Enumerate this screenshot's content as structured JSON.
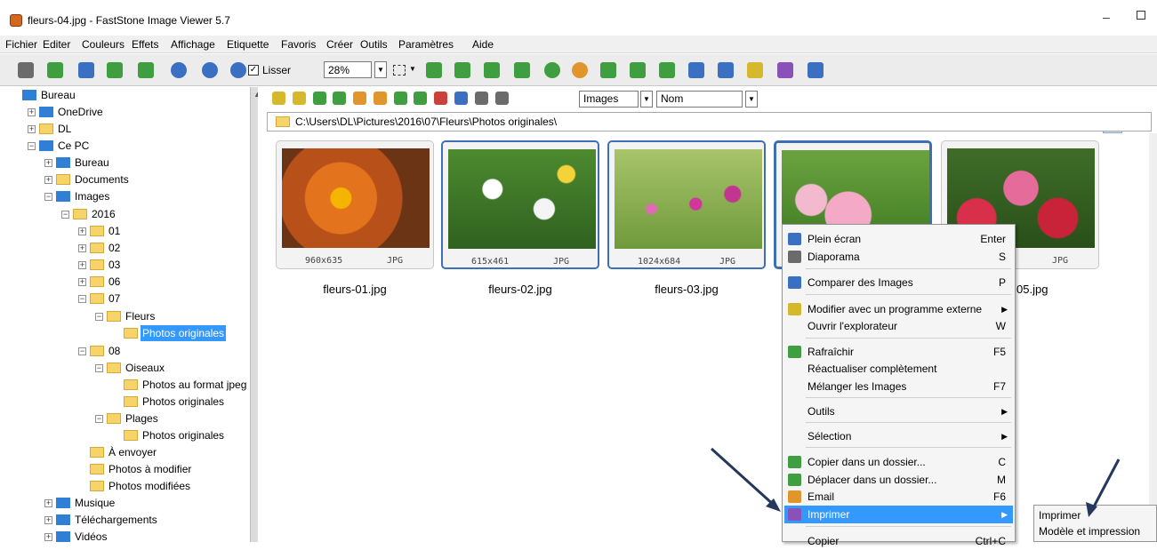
{
  "window": {
    "title": "fleurs-04.jpg  -  FastStone Image Viewer 5.7",
    "minimize_glyph": "–"
  },
  "menu": [
    "Fichier",
    "Editer",
    "Couleurs",
    "Effets",
    "Affichage",
    "Etiquette",
    "Favoris",
    "Créer",
    "Outils",
    "Paramètres",
    "Aide"
  ],
  "toolbar": {
    "smooth_label": "Lisser",
    "smooth_checked": true,
    "zoom": "28%"
  },
  "nav": {
    "filter": "Images",
    "sort": "Nom"
  },
  "path": "C:\\Users\\DL\\Pictures\\2016\\07\\Fleurs\\Photos originales\\",
  "tree": [
    {
      "label": "Bureau",
      "icon": "desktop-icon"
    },
    {
      "label": "OneDrive",
      "icon": "cloud-icon"
    },
    {
      "label": "DL",
      "icon": "user-icon"
    },
    {
      "label": "Ce PC",
      "icon": "computer-icon"
    },
    {
      "label": "Bureau",
      "icon": "desktop-icon"
    },
    {
      "label": "Documents",
      "icon": "documents-icon"
    },
    {
      "label": "Images",
      "icon": "images-icon"
    },
    {
      "label": "2016",
      "icon": "folder-icon"
    },
    {
      "label": "01",
      "icon": "folder-icon"
    },
    {
      "label": "02",
      "icon": "folder-icon"
    },
    {
      "label": "03",
      "icon": "folder-icon"
    },
    {
      "label": "06",
      "icon": "folder-icon"
    },
    {
      "label": "07",
      "icon": "folder-icon"
    },
    {
      "label": "Fleurs",
      "icon": "folder-icon"
    },
    {
      "label": "Photos originales",
      "icon": "folder-icon",
      "selected": true
    },
    {
      "label": "08",
      "icon": "folder-icon"
    },
    {
      "label": "Oiseaux",
      "icon": "folder-icon"
    },
    {
      "label": "Photos au format jpeg",
      "icon": "folder-icon"
    },
    {
      "label": "Photos originales",
      "icon": "folder-icon"
    },
    {
      "label": "Plages",
      "icon": "folder-icon"
    },
    {
      "label": "Photos originales",
      "icon": "folder-icon"
    },
    {
      "label": "À envoyer",
      "icon": "folder-icon"
    },
    {
      "label": "Photos à modifier",
      "icon": "folder-icon"
    },
    {
      "label": "Photos modifiées",
      "icon": "folder-icon"
    },
    {
      "label": "Musique",
      "icon": "music-icon"
    },
    {
      "label": "Téléchargements",
      "icon": "download-icon"
    },
    {
      "label": "Vidéos",
      "icon": "video-icon"
    }
  ],
  "thumbnails": [
    {
      "dims": "960x635",
      "format": "JPG",
      "name": "fleurs-01.jpg"
    },
    {
      "dims": "615x461",
      "format": "JPG",
      "name": "fleurs-02.jpg"
    },
    {
      "dims": "1024x684",
      "format": "JPG",
      "name": "fleurs-03.jpg"
    },
    {
      "dims": "",
      "format": "",
      "name": ""
    },
    {
      "dims": "",
      "format": "JPG",
      "name": "05.jpg"
    }
  ],
  "context_menu": [
    {
      "label": "Plein écran",
      "key": "Enter",
      "icon": "fullscreen-icon"
    },
    {
      "label": "Diaporama",
      "key": "S",
      "icon": "slideshow-icon"
    },
    {
      "label": "Comparer des Images",
      "key": "P",
      "icon": "compare-icon"
    },
    {
      "label": "Modifier avec un programme externe",
      "key": "",
      "icon": "external-edit-icon",
      "submenu": true
    },
    {
      "label": "Ouvrir l'explorateur",
      "key": "W",
      "icon": ""
    },
    {
      "label": "Rafraîchir",
      "key": "F5",
      "icon": "refresh-icon"
    },
    {
      "label": "Réactualiser complètement",
      "key": "",
      "icon": ""
    },
    {
      "label": "Mélanger les Images",
      "key": "F7",
      "icon": ""
    },
    {
      "label": "Outils",
      "key": "",
      "icon": "",
      "submenu": true
    },
    {
      "label": "Sélection",
      "key": "",
      "icon": "",
      "submenu": true
    },
    {
      "label": "Copier dans un dossier...",
      "key": "C",
      "icon": "copy-to-folder-icon"
    },
    {
      "label": "Déplacer dans un dossier...",
      "key": "M",
      "icon": "move-to-folder-icon"
    },
    {
      "label": "Email",
      "key": "F6",
      "icon": "email-icon"
    },
    {
      "label": "Imprimer",
      "key": "",
      "icon": "print-icon",
      "submenu": true,
      "highlighted": true
    },
    {
      "label": "Copier",
      "key": "Ctrl+C",
      "icon": ""
    }
  ],
  "submenu": [
    "Imprimer",
    "Modèle et impression"
  ],
  "colors": {
    "selection": "#3399ff",
    "thumb_border": "#3d6fb6"
  }
}
